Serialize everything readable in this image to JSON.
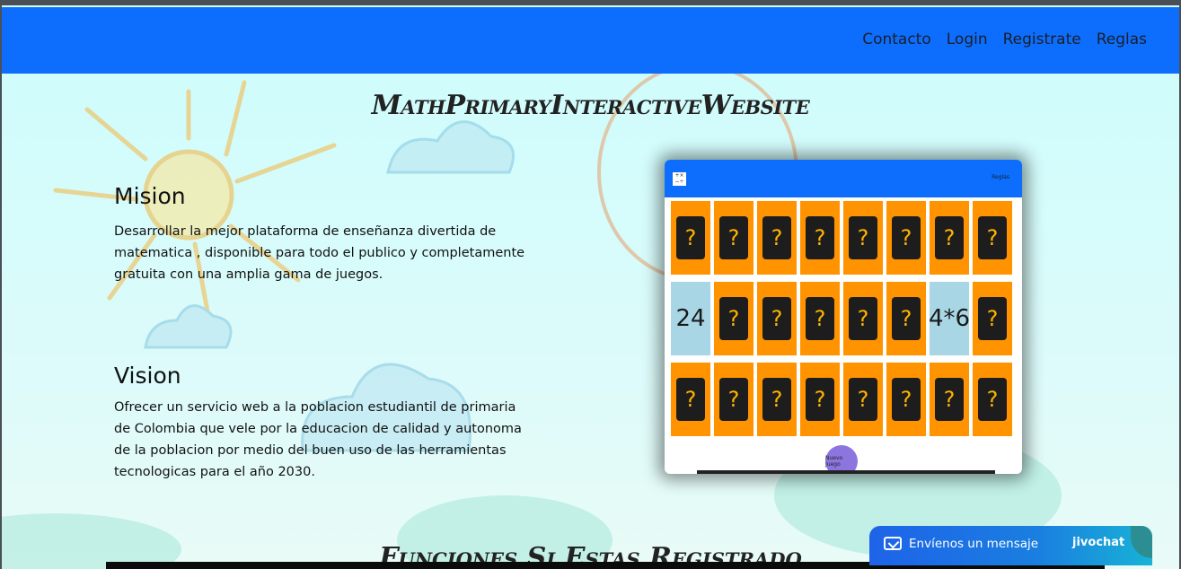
{
  "nav": {
    "links": [
      "Contacto",
      "Login",
      "Registrate",
      "Reglas"
    ]
  },
  "page": {
    "title": "MathPrimaryInteractiveWebsite",
    "mission_title": "Mision",
    "mission_text": "Desarrollar la mejor plataforma de enseñanza divertida de matematica , disponible para todo el publico y completamente gratuita con una amplia gama de juegos.",
    "vision_title": "Vision",
    "vision_text": "Ofrecer un servicio web a la poblacion estudiantil de primaria de Colombia que vele por la educacion de calidad y autonoma de la poblacion por medio del buen uso de las herramientas tecnologicas para el año 2030.",
    "funciones_title": "Funciones Si Estas Registrado"
  },
  "preview": {
    "nav_text": "Reglas",
    "button_label": "Nuevo Juego",
    "rows": [
      [
        "?",
        "?",
        "?",
        "?",
        "?",
        "?",
        "?",
        "?"
      ],
      [
        "24",
        "?",
        "?",
        "?",
        "?",
        "?",
        "4*6",
        "?"
      ],
      [
        "?",
        "?",
        "?",
        "?",
        "?",
        "?",
        "?",
        "?"
      ]
    ]
  },
  "chat": {
    "message": "Envíenos un mensaje",
    "brand": "jivochat"
  },
  "colors": {
    "navbar": "#0d6efd",
    "card_hidden": "#ff9300",
    "card_revealed": "#a9d6e5",
    "background": "#d4fbfb"
  }
}
